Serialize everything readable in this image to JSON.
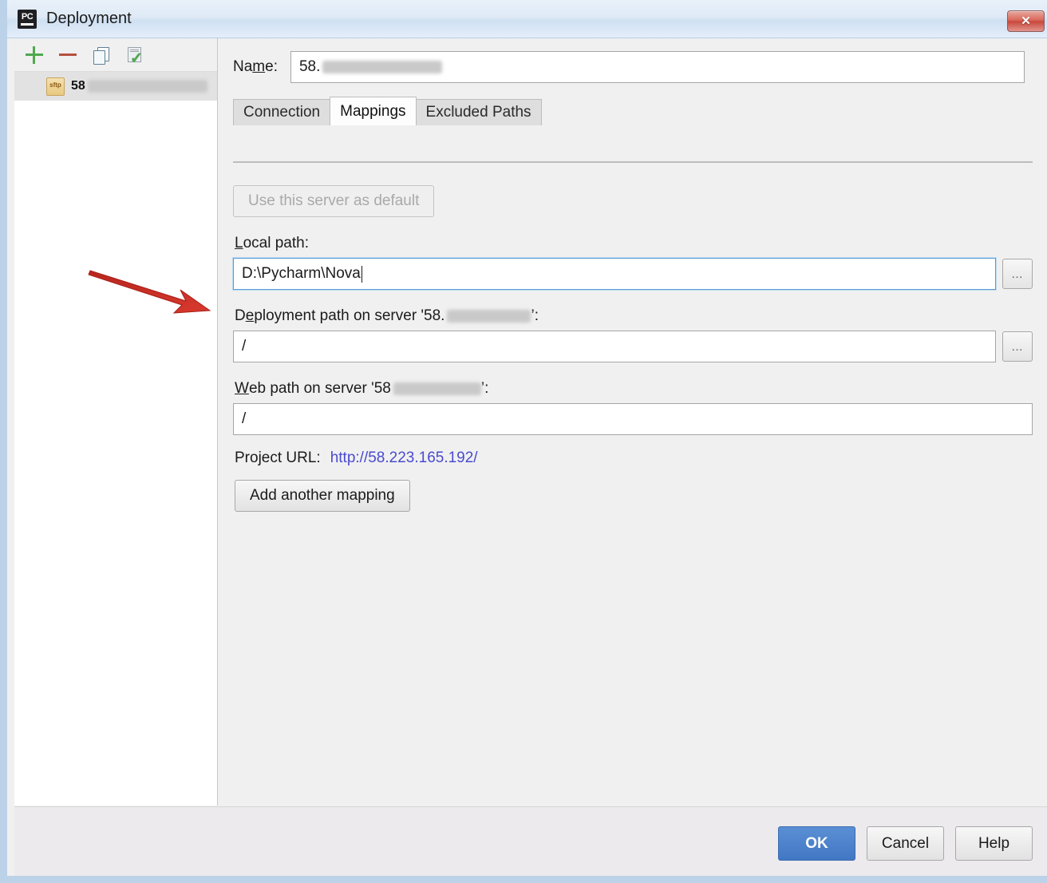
{
  "window": {
    "title": "Deployment",
    "app_icon": "pycharm-icon",
    "icon_text": "PC",
    "close_label": "✕"
  },
  "toolbar": {
    "items": [
      {
        "name": "add-server-button",
        "icon": "plus-icon",
        "label": "+"
      },
      {
        "name": "remove-server-button",
        "icon": "minus-icon",
        "label": "−"
      },
      {
        "name": "copy-server-button",
        "icon": "copy-icon",
        "label": ""
      },
      {
        "name": "set-default-server-button",
        "icon": "check-document-icon",
        "label": ""
      }
    ]
  },
  "server_list": {
    "items": [
      {
        "protocol_badge": "sftp",
        "name_visible": "58",
        "redacted_width": 150,
        "selected": true
      }
    ]
  },
  "settings": {
    "name_label": "Name:",
    "name_mnemonic": "m",
    "name_value_visible": "58.",
    "name_redacted_width": 150,
    "tabs": [
      {
        "label": "Connection",
        "active": false
      },
      {
        "label": "Mappings",
        "active": true
      },
      {
        "label": "Excluded Paths",
        "active": false
      }
    ],
    "use_default_button": {
      "label": "Use this server as default",
      "disabled": true
    },
    "local_path": {
      "label": "Local path:",
      "mnemonic": "L",
      "value": "D:\\Pycharm\\Nova",
      "focused": true,
      "browse_label": "…"
    },
    "deployment_path": {
      "label_before": "D",
      "mnemonic": "e",
      "label_prefix": "ployment path on server '58.",
      "label_suffix": "’:",
      "redacted_width": 105,
      "value": "/",
      "browse_label": "…"
    },
    "web_path": {
      "mnemonic": "W",
      "label_prefix": "eb path on server '58",
      "label_suffix": "’:",
      "redacted_width": 110,
      "value": "/"
    },
    "project_url": {
      "label": "Project URL:",
      "url": "http://58.223.165.192/"
    },
    "add_mapping_button": {
      "label": "Add another mapping"
    }
  },
  "footer": {
    "ok_label": "OK",
    "cancel_label": "Cancel",
    "help_label": "Help"
  },
  "annotation": {
    "type": "red-arrow",
    "color": "#c32a22",
    "points_to": "deployment-path-input"
  },
  "colors": {
    "accent_blue": "#4277c4",
    "link": "#4a4ad0",
    "annotation_red": "#c32a22",
    "window_border": "#bcd2e8"
  }
}
